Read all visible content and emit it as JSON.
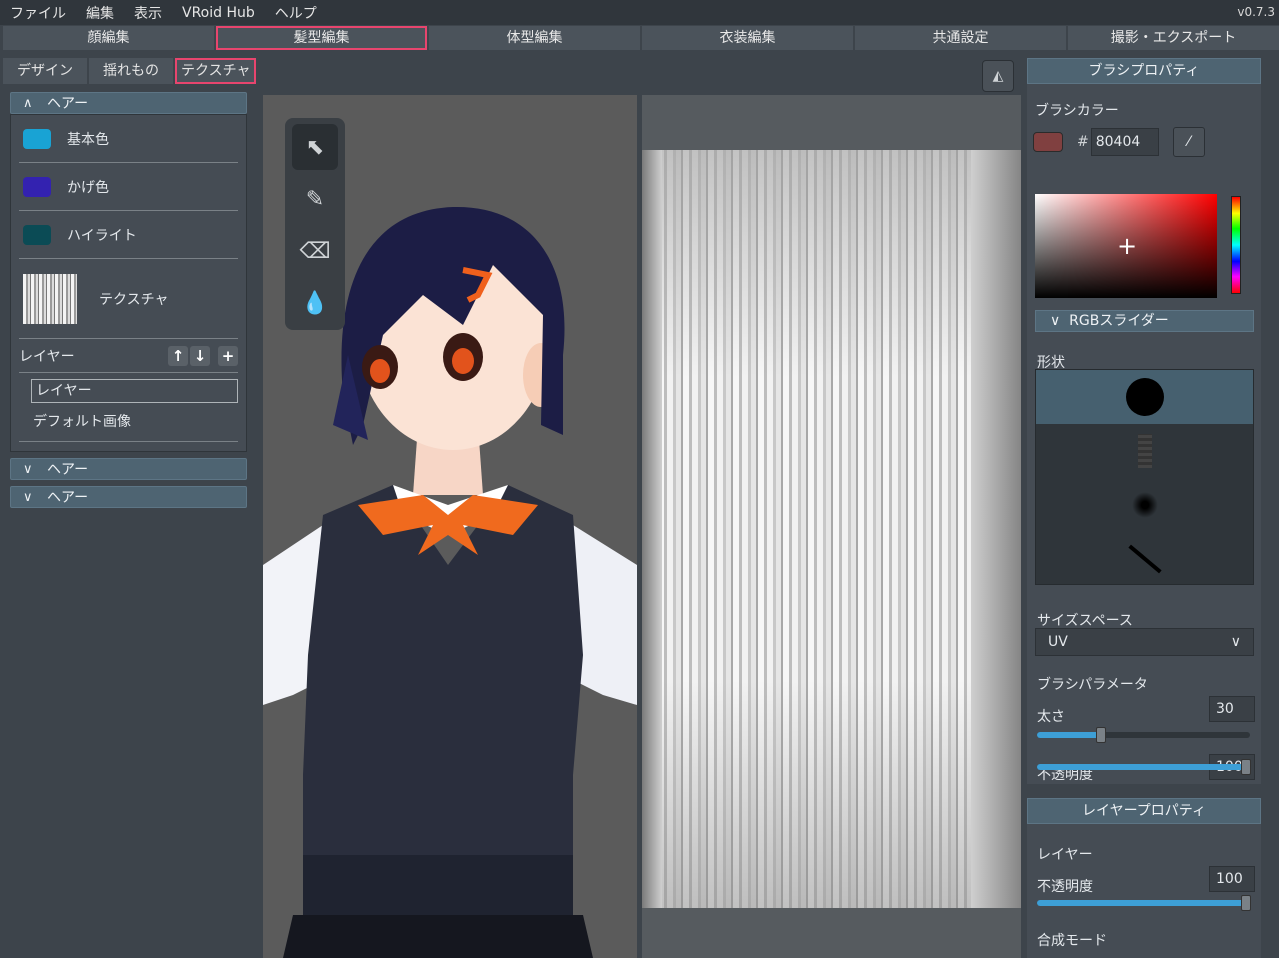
{
  "menu": {
    "items": [
      "ファイル",
      "編集",
      "表示",
      "VRoid Hub",
      "ヘルプ"
    ],
    "version": "v0.7.3"
  },
  "top_tabs": [
    "顔編集",
    "髪型編集",
    "体型編集",
    "衣装編集",
    "共通設定",
    "撮影・エクスポート"
  ],
  "sub_tabs": [
    "デザイン",
    "揺れもの",
    "テクスチャ"
  ],
  "left_panel": {
    "section_title": "ヘアー",
    "colors": [
      {
        "label": "基本色",
        "color": "#19a3d4"
      },
      {
        "label": "かげ色",
        "color": "#3322b0"
      },
      {
        "label": "ハイライト",
        "color": "#0b4b55"
      }
    ],
    "texture_label": "テクスチャ",
    "layer_label": "レイヤー",
    "layer_items": [
      "レイヤー",
      "デフォルト画像"
    ],
    "collapsed_sections": [
      "ヘアー",
      "ヘアー"
    ]
  },
  "right_panel": {
    "brush_title": "ブラシプロパティ",
    "brush_color_label": "ブラシカラー",
    "hex_value": "80404",
    "hash": "#",
    "rgb_slider_label": "RGBスライダー",
    "shape_label": "形状",
    "size_space_label": "サイズスペース",
    "size_space_value": "UV",
    "brush_param_label": "ブラシパラメータ",
    "thickness_label": "太さ",
    "thickness_value": "30",
    "thickness_fraction": 0.3,
    "opacity_label": "不透明度",
    "opacity_value": "100",
    "layer_prop_title": "レイヤープロパティ",
    "layer_label": "レイヤー",
    "layer_opacity_label": "不透明度",
    "layer_opacity_value": "100",
    "blend_mode_label": "合成モード"
  },
  "colors": {
    "highlight": "#e8456e",
    "accent": "#3d9fd6"
  }
}
